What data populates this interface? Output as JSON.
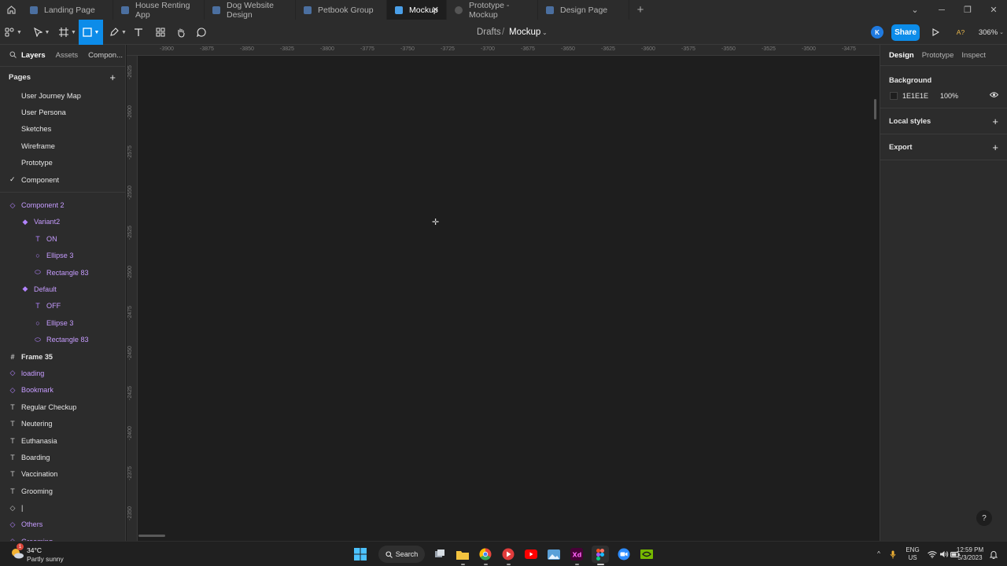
{
  "tabs": [
    {
      "label": "Landing Page",
      "icon": "figma-file-icon"
    },
    {
      "label": "House Renting App",
      "icon": "figma-file-icon"
    },
    {
      "label": "Dog Website Design",
      "icon": "figma-file-icon"
    },
    {
      "label": "Petbook Group",
      "icon": "figma-file-icon"
    },
    {
      "label": "Mockup",
      "icon": "figma-file-icon",
      "active": true
    },
    {
      "label": "Prototype - Mockup",
      "icon": "prototype-icon"
    },
    {
      "label": "Design Page",
      "icon": "figma-file-icon"
    }
  ],
  "toolbar": {
    "breadcrumb_root": "Drafts",
    "breadcrumb_sep": "/",
    "file_name": "Mockup",
    "avatar_initial": "K",
    "share_label": "Share",
    "font_warning": "A?",
    "zoom": "306%"
  },
  "left_panel": {
    "tabs": [
      "Layers",
      "Assets",
      "Compon..."
    ],
    "pages_title": "Pages",
    "pages": [
      "User Journey Map",
      "User Persona",
      "Sketches",
      "Wireframe",
      "Prototype",
      "Component"
    ],
    "current_page": "Component",
    "layers": [
      {
        "label": "Component 2",
        "icon": "◇",
        "level": 0,
        "purple": true
      },
      {
        "label": "Variant2",
        "icon": "◆",
        "level": 1,
        "purple": true
      },
      {
        "label": "ON",
        "icon": "T",
        "level": 2,
        "purple": true
      },
      {
        "label": "Ellipse 3",
        "icon": "○",
        "level": 2,
        "purple": true
      },
      {
        "label": "Rectangle 83",
        "icon": "⬭",
        "level": 2,
        "purple": true
      },
      {
        "label": "Default",
        "icon": "◆",
        "level": 1,
        "purple": true
      },
      {
        "label": "OFF",
        "icon": "T",
        "level": 2,
        "purple": true
      },
      {
        "label": "Ellipse 3",
        "icon": "○",
        "level": 2,
        "purple": true
      },
      {
        "label": "Rectangle 83",
        "icon": "⬭",
        "level": 2,
        "purple": true
      },
      {
        "label": "Frame 35",
        "icon": "#",
        "level": 0,
        "purple": false,
        "bold": true
      },
      {
        "label": "loading",
        "icon": "◇",
        "level": 0,
        "purple": true
      },
      {
        "label": "Bookmark",
        "icon": "◇",
        "level": 0,
        "purple": true
      },
      {
        "label": "Regular Checkup",
        "icon": "T",
        "level": 0,
        "purple": false
      },
      {
        "label": "Neutering",
        "icon": "T",
        "level": 0,
        "purple": false
      },
      {
        "label": "Euthanasia",
        "icon": "T",
        "level": 0,
        "purple": false
      },
      {
        "label": "Boarding",
        "icon": "T",
        "level": 0,
        "purple": false
      },
      {
        "label": "Vaccination",
        "icon": "T",
        "level": 0,
        "purple": false
      },
      {
        "label": "Grooming",
        "icon": "T",
        "level": 0,
        "purple": false
      },
      {
        "label": "|",
        "icon": "◇",
        "level": 0,
        "purple": false
      },
      {
        "label": "Others",
        "icon": "◇",
        "level": 0,
        "purple": true
      },
      {
        "label": "Grooming",
        "icon": "◇",
        "level": 0,
        "purple": true
      }
    ]
  },
  "rulers": {
    "top": [
      "-3900",
      "-3875",
      "-3850",
      "-3825",
      "-3800",
      "-3775",
      "-3750",
      "-3725",
      "-3700",
      "-3675",
      "-3650",
      "-3625",
      "-3600",
      "-3575",
      "-3550",
      "-3525",
      "-3500",
      "-3475"
    ],
    "left": [
      "-2625",
      "-2600",
      "-2575",
      "-2550",
      "-2525",
      "-2500",
      "-2475",
      "-2450",
      "-2425",
      "-2400",
      "-2375",
      "-2350"
    ]
  },
  "right_panel": {
    "tabs": [
      "Design",
      "Prototype",
      "Inspect"
    ],
    "background_title": "Background",
    "background_hex": "1E1E1E",
    "background_opacity": "100%",
    "local_styles": "Local styles",
    "export": "Export",
    "help": "?"
  },
  "taskbar": {
    "weather_temp": "34°C",
    "weather_desc": "Partly sunny",
    "weather_badge": "1",
    "search_label": "Search",
    "lang": "ENG",
    "region": "US",
    "time": "12:59 PM",
    "date": "5/3/2023"
  },
  "colors": {
    "accent": "#0c8ce9",
    "panel": "#2c2c2c",
    "canvas": "#1e1e1e",
    "component_purple": "#c69cff"
  }
}
